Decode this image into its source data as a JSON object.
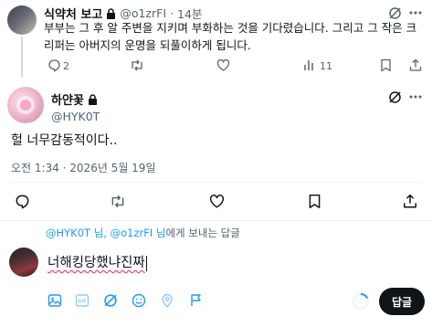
{
  "parent_tweet": {
    "name": "식약처 보고",
    "handle": "@o1zrFI",
    "time": "14분",
    "text": "부부는 그 후 알 주변을 지키며 부화하는 것을 기다렸습니다. 그리고 그 작은 크리퍼는 아버지의 운명을 되풀이하게 됩니다.",
    "reply_count": "2",
    "view_count": "11"
  },
  "main_tweet": {
    "name": "하얀꽃",
    "handle": "@HYK0T",
    "text": "헐 너무감동적이다..",
    "timestamp": "오전 1:34 · 2026년 5월 19일"
  },
  "compose": {
    "replying_to_handles": "@HYK0T 님, @o1zrFI 님",
    "replying_to_suffix": "에게 보내는 답글",
    "draft_text": "너해킹당했냐진짜",
    "reply_button": "답글"
  },
  "colors": {
    "accent": "#1d9bf0",
    "text_primary": "#0f1419",
    "text_secondary": "#536471",
    "button_bg": "#0f1419",
    "spellcheck": "#e0245e"
  },
  "icons": {
    "lock": "lock-icon",
    "grok": "grok-icon",
    "more": "more-icon",
    "reply": "reply-icon",
    "retweet": "retweet-icon",
    "like": "like-icon",
    "views": "views-icon",
    "bookmark": "bookmark-icon",
    "share": "share-icon"
  }
}
